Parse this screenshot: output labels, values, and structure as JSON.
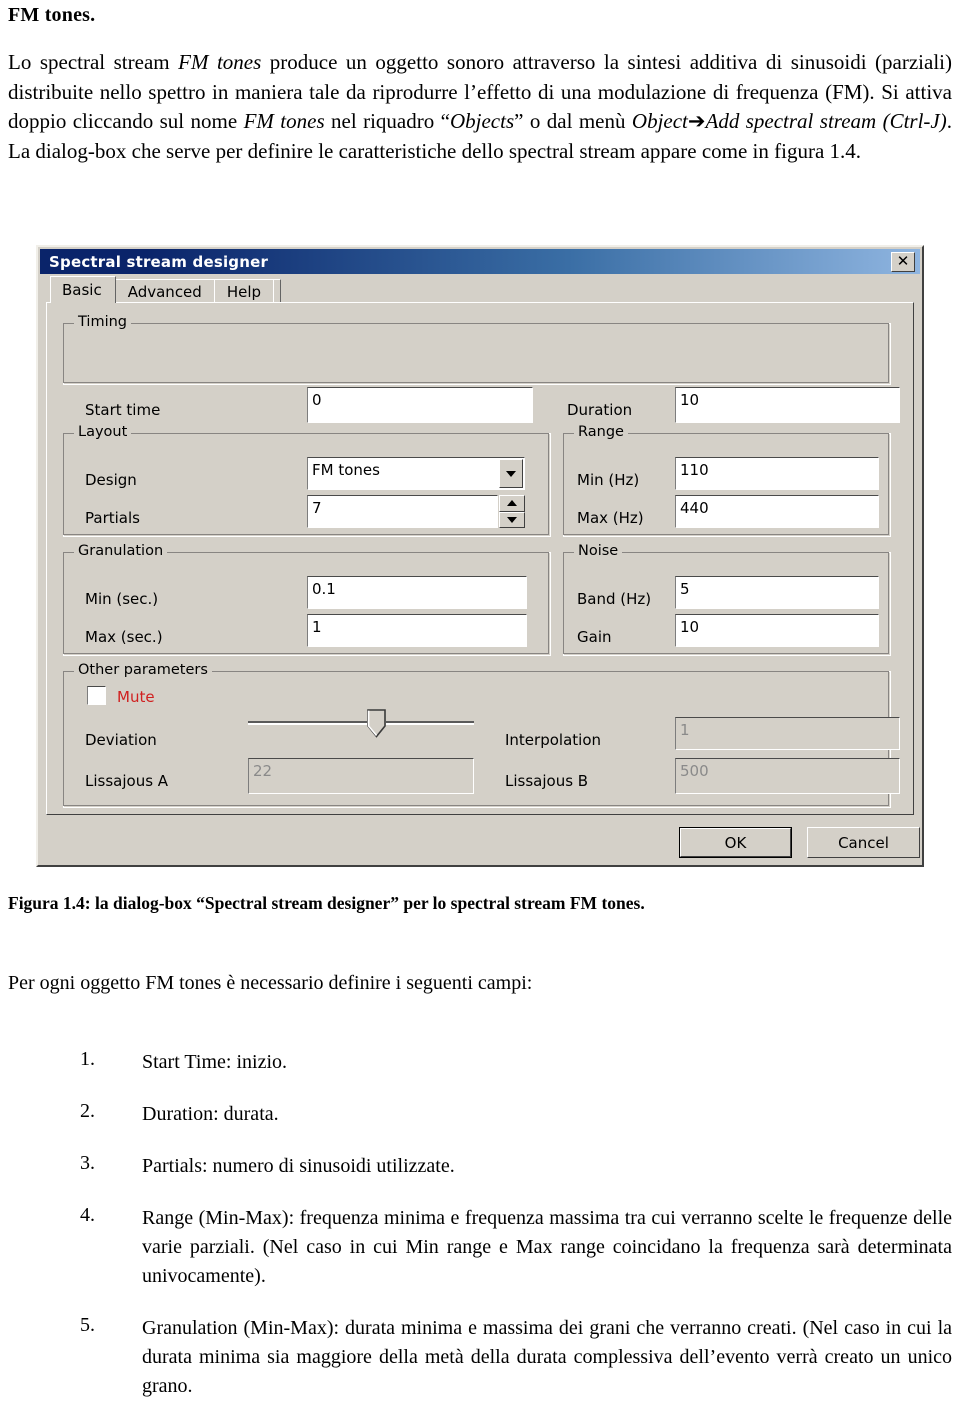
{
  "document": {
    "heading": "FM tones.",
    "intro_html": "Lo spectral stream <i>FM tones</i> produce un oggetto sonoro attraverso la sintesi additiva di sinusoidi (parziali) distribuite nello spettro in maniera tale da riprodurre l’effetto di una modulazione di frequenza (FM). Si attiva doppio cliccando sul nome <i>FM tones</i> nel riquadro “<i>Objects</i>” o dal menù <i>Object</i>➔<i>Add spectral stream (Ctrl-J)</i>. La dialog-box che serve per definire le caratteristiche dello spectral stream appare come in figura 1.4.",
    "figure_caption": "Figura 1.4: la dialog-box “Spectral stream designer” per lo spectral stream FM tones.",
    "lead_in": "Per ogni oggetto FM tones è necessario definire i seguenti campi:",
    "list": [
      {
        "num": "1.",
        "text": "Start Time: inizio."
      },
      {
        "num": "2.",
        "text": "Duration: durata."
      },
      {
        "num": "3.",
        "text": "Partials: numero di sinusoidi utilizzate."
      },
      {
        "num": "4.",
        "text": "Range (Min-Max): frequenza minima e frequenza massima tra cui verranno scelte le frequenze delle varie parziali. (Nel caso in cui Min range e Max range coincidano la frequenza sarà determinata univocamente)."
      },
      {
        "num": "5.",
        "text": "Granulation (Min-Max): durata minima e massima dei grani che verranno creati. (Nel caso in cui la durata minima sia maggiore della metà della durata complessiva dell’evento verrà creato un unico grano."
      }
    ]
  },
  "dialog": {
    "title": "Spectral stream designer",
    "close_label": "✕",
    "tabs": [
      {
        "label": "Basic",
        "selected": true
      },
      {
        "label": "Advanced",
        "selected": false
      },
      {
        "label": "Help",
        "selected": false
      }
    ],
    "groups": {
      "timing": {
        "label": "Timing",
        "start_time_label": "Start time",
        "start_time_value": "0",
        "duration_label": "Duration",
        "duration_value": "10"
      },
      "layout": {
        "label": "Layout",
        "design_label": "Design",
        "design_value": "FM tones",
        "partials_label": "Partials",
        "partials_value": "7"
      },
      "range": {
        "label": "Range",
        "min_label": "Min (Hz)",
        "min_value": "110",
        "max_label": "Max (Hz)",
        "max_value": "440"
      },
      "granulation": {
        "label": "Granulation",
        "min_label": "Min (sec.)",
        "min_value": "0.1",
        "max_label": "Max (sec.)",
        "max_value": "1"
      },
      "noise": {
        "label": "Noise",
        "band_label": "Band (Hz)",
        "band_value": "5",
        "gain_label": "Gain",
        "gain_value": "10"
      },
      "other": {
        "label": "Other parameters",
        "mute_label": "Mute",
        "mute_checked": false,
        "deviation_label": "Deviation",
        "deviation_position_percent": 57,
        "interpolation_label": "Interpolation",
        "interpolation_value": "1",
        "lissajous_a_label": "Lissajous A",
        "lissajous_a_value": "22",
        "lissajous_b_label": "Lissajous B",
        "lissajous_b_value": "500"
      }
    },
    "buttons": {
      "ok": "OK",
      "cancel": "Cancel"
    },
    "colors": {
      "face": "#d4d0c8",
      "title_left": "#0a246a",
      "title_right": "#8fb5e0",
      "mute_red": "#d02020"
    }
  }
}
